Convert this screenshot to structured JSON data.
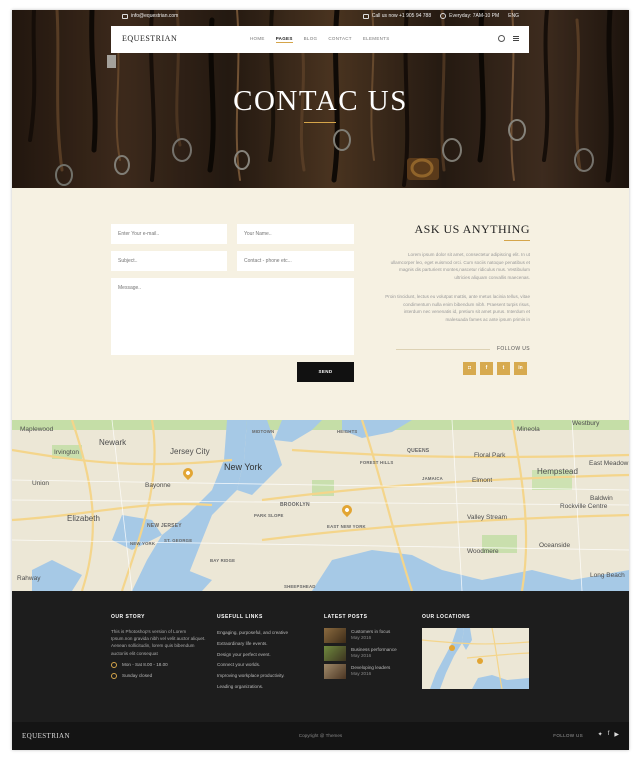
{
  "topbar": {
    "email": "info@equestrian.com",
    "phone": "Call us now +1 905 94 788",
    "hours": "Everyday: 7AM-10 PM",
    "language": "ENG"
  },
  "nav": {
    "logo": "EQUESTRIAN",
    "items": [
      {
        "label": "HOME",
        "active": false
      },
      {
        "label": "PAGES",
        "active": true
      },
      {
        "label": "BLOG",
        "active": false
      },
      {
        "label": "CONTACT",
        "active": false
      },
      {
        "label": "ELEMENTS",
        "active": false
      }
    ]
  },
  "hero": {
    "title": "CONTAC US"
  },
  "form": {
    "email_placeholder": "Enter Your e-mail..",
    "name_placeholder": "Your Name..",
    "subject_placeholder": "Subject..",
    "contact_placeholder": "Contact - phone etc...",
    "message_placeholder": "Message..",
    "send_label": "SEND"
  },
  "ask": {
    "title": "ASK US ANYTHING",
    "paragraph1": "Lorem ipsum dolor sit amet, consectetur adipiscing elit. In ut ullamcorper leo, eget euismod orci. Cum sociis natoque penatibus et magnis dis parturient montes,nascetur ridiculus mus. Vestibulum ultricies aliquam convallis maecenas.",
    "paragraph2": "Proin tincidunt, lectus eu volutpat mattis, ante metus lacinia tellus, vitae condimentum nulla enim bibendum nibh. Praesent turpis risus, interdum nec venenatis id, pretium sit amet purus. Interdum et malesuada fames ac ante ipsum primis in",
    "follow_label": "FOLLOW US",
    "socials": [
      "instagram",
      "facebook",
      "twitter",
      "linkedin"
    ],
    "accent_color": "#d7aa4f"
  },
  "map": {
    "labels": {
      "maplewood": "Maplewood",
      "newark": "Newark",
      "irvington": "Irvington",
      "jersey_city": "Jersey City",
      "union": "Union",
      "elizabeth": "Elizabeth",
      "bayonne": "Bayonne",
      "new_jersey": "NEW JERSEY",
      "new_york_sm": "NEW YORK",
      "rahway": "Rahway",
      "new_york": "New York",
      "midtown": "MIDTOWN",
      "heights": "HEIGHTS",
      "queens": "QUEENS",
      "forest_hills": "FOREST HILLS",
      "jamaica": "JAMAICA",
      "brooklyn": "BROOKLYN",
      "park_slope": "PARK SLOPE",
      "east_new_york": "EAST NEW YORK",
      "bay_ridge": "BAY RIDGE",
      "sheepshead": "SHEEPSHEAD",
      "st_george": "ST. GEORGE",
      "mineola": "Mineola",
      "westbury": "Westbury",
      "floral_park": "Floral Park",
      "elmont": "Elmont",
      "hempstead": "Hempstead",
      "east_meadow": "East Meadow",
      "valley_stream": "Valley Stream",
      "rockville_centre": "Rockville Centre",
      "baldwin": "Baldwin",
      "woodmere": "Woodmere",
      "oceanside": "Oceanside",
      "long_beach": "Long Beach"
    }
  },
  "footer": {
    "story_title": "OUR STORY",
    "story_text": "This is Photoshop's version of Lorem Ipsum.non gravida nibh vel velit auctor aliquet. Aenean sollicitudin, lorem quis bibendum auctoriis elit consequat",
    "hours_weekdays": "Mon - Sat 8.00 - 18.00",
    "hours_sunday": "Sunday closed",
    "links_title": "USEFULL LINKS",
    "links": [
      "Engaging, purposeful, and creative",
      "Extraordinary life events.",
      "Design your perfect event.",
      "Connect your worlds.",
      "Improving workplace productivity.",
      "Leading organizations."
    ],
    "posts_title": "LATEST POSTS",
    "posts": [
      {
        "title": "Customers in focus",
        "date": "May 2016"
      },
      {
        "title": "Business performance",
        "date": "May 2016"
      },
      {
        "title": "Developing leaders",
        "date": "May 2016"
      }
    ],
    "locations_title": "OUR LOCATIONS",
    "logo": "EQUESTRIAN",
    "copyright": "Copyright @ Themes",
    "follow_label": "FOLLOW US"
  }
}
